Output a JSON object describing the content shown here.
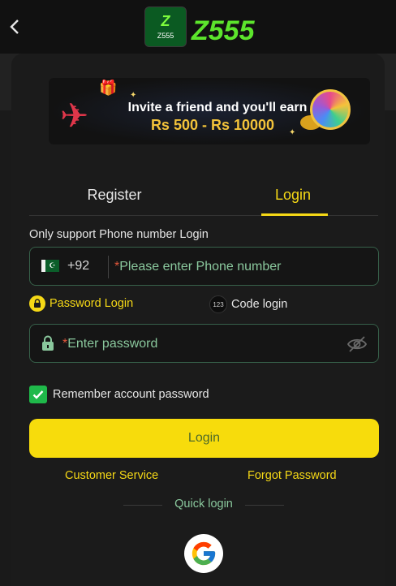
{
  "header": {
    "back_icon": "chevron-left-icon",
    "logo_badge_text": "Z555",
    "logo_text": "Z555"
  },
  "banner": {
    "line1": "Invite a friend and you'll earn",
    "line2": "Rs 500 - Rs 10000"
  },
  "tabs": [
    {
      "label": "Register",
      "active": false
    },
    {
      "label": "Login",
      "active": true
    }
  ],
  "login": {
    "hint": "Only support Phone number Login",
    "country_code": "+92",
    "phone_required_mark": "*",
    "phone_placeholder": "Please enter Phone number",
    "mode_password_label": "Password Login",
    "mode_code_label": "Code login",
    "mode_code_icon_text": "123",
    "password_required_mark": "*",
    "password_placeholder": "Enter password",
    "remember_label": "Remember account password",
    "remember_checked": true,
    "login_button": "Login",
    "customer_service": "Customer Service",
    "forgot_password": "Forgot Password",
    "quick_login": "Quick login"
  },
  "colors": {
    "accent": "#f5d816",
    "field_border": "#37614a",
    "placeholder": "#8ac89d",
    "check": "#1fb94a",
    "background": "#1b1b1b"
  }
}
